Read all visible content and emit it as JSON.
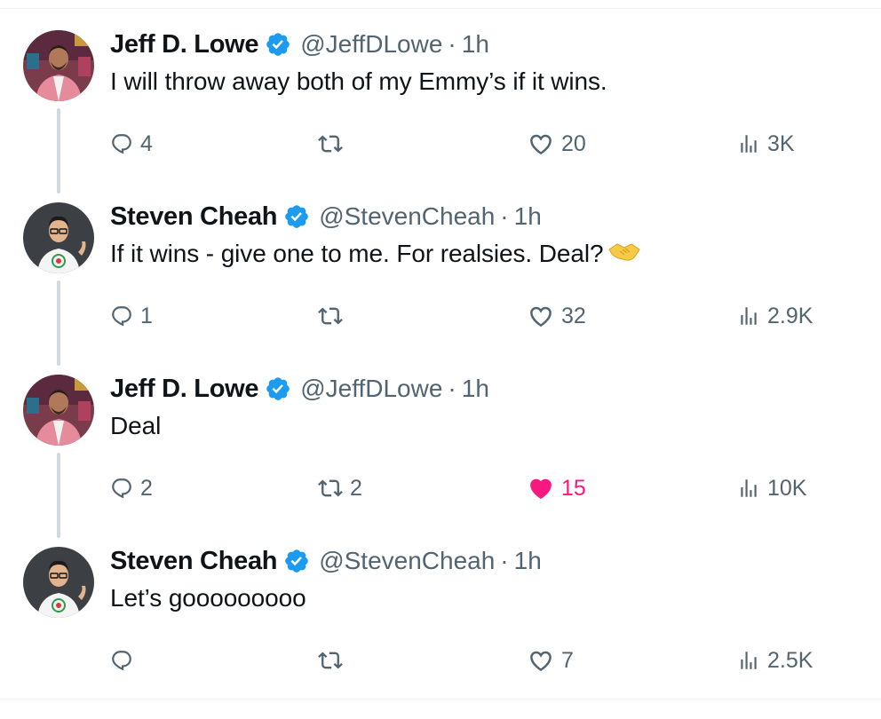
{
  "tweets": [
    {
      "name": "Jeff D. Lowe",
      "handle": "@JeffDLowe",
      "time": "1h",
      "text": "I will throw away both of my Emmy’s if it wins.",
      "replies": "4",
      "retweets": "",
      "likes": "20",
      "views": "3K",
      "liked": false
    },
    {
      "name": "Steven Cheah",
      "handle": "@StevenCheah",
      "time": "1h",
      "text": "If it wins - give one to me. For realsies. Deal?",
      "emoji": "handshake-emoji",
      "replies": "1",
      "retweets": "",
      "likes": "32",
      "views": "2.9K",
      "liked": false
    },
    {
      "name": "Jeff D. Lowe",
      "handle": "@JeffDLowe",
      "time": "1h",
      "text": "Deal",
      "replies": "2",
      "retweets": "2",
      "likes": "15",
      "views": "10K",
      "liked": true
    },
    {
      "name": "Steven Cheah",
      "handle": "@StevenCheah",
      "time": "1h",
      "text": "Let’s gooooooooo",
      "replies": "",
      "retweets": "",
      "likes": "7",
      "views": "2.5K",
      "liked": false
    }
  ],
  "separator": "·",
  "colors": {
    "verified_badge": "#1d9bf0",
    "meta_text": "#536471",
    "like_active": "#f91880",
    "thread_line": "#cfd9de"
  },
  "icons": [
    "reply-icon",
    "retweet-icon",
    "like-icon",
    "views-icon",
    "verified-badge-icon"
  ]
}
